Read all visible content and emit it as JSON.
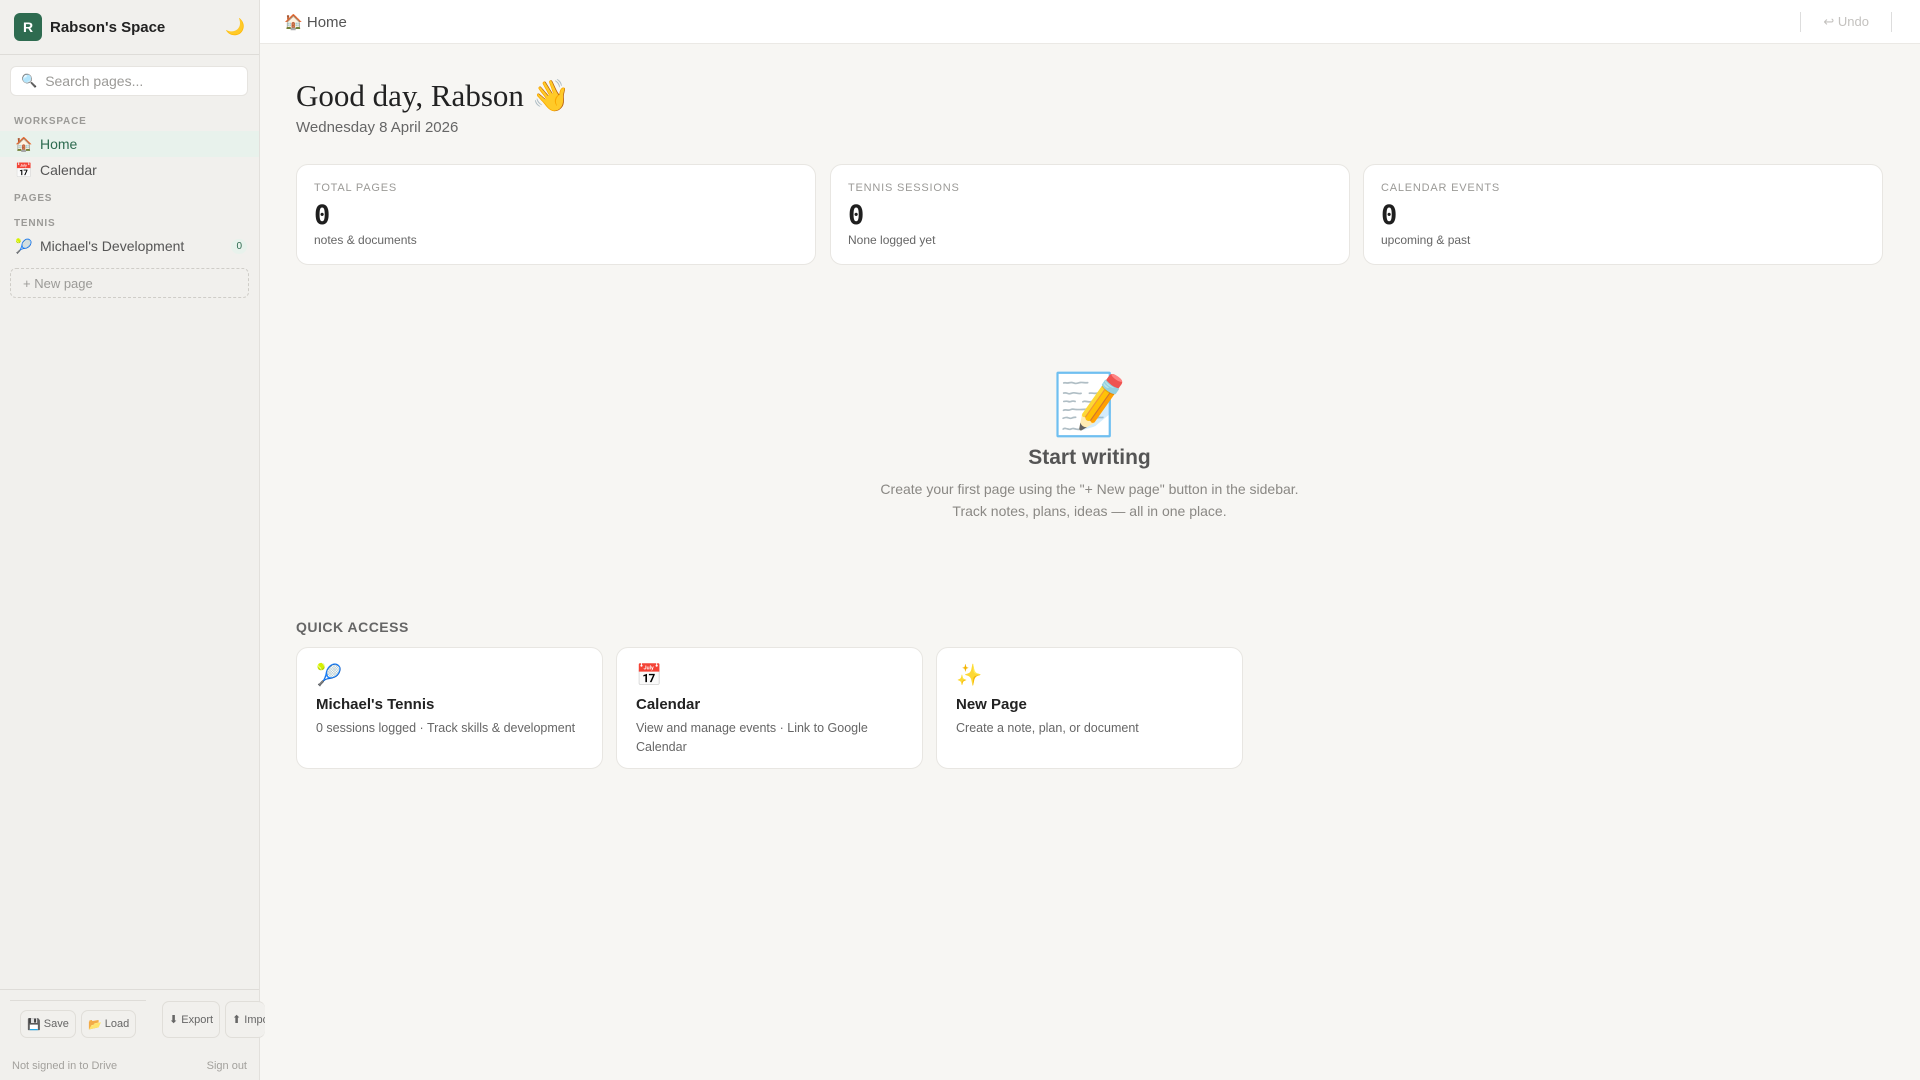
{
  "sidebar": {
    "logo_letter": "R",
    "workspace_name": "Rabson's Space",
    "search_placeholder": "Search pages...",
    "sections": {
      "workspace": "WORKSPACE",
      "pages": "PAGES",
      "tennis": "TENNIS"
    },
    "items": [
      {
        "label": "Home",
        "icon": "🏠"
      },
      {
        "label": "Calendar",
        "icon": "📅"
      },
      {
        "label": "Michael's Development",
        "icon": "🎾",
        "count": "0"
      }
    ],
    "new_page": "+ New page",
    "footer": {
      "save": "Save",
      "load": "Load",
      "export": "Export",
      "import": "Import",
      "status": "Not signed in to Drive",
      "sign_out": "Sign out"
    }
  },
  "topbar": {
    "breadcrumb": "Home",
    "breadcrumb_icon": "🏠",
    "undo": "↩ Undo"
  },
  "main": {
    "greeting": "Good day, Rabson 👋",
    "date": "Wednesday 8 April 2026",
    "stats": [
      {
        "label": "TOTAL PAGES",
        "value": "0",
        "sub": "notes & documents"
      },
      {
        "label": "TENNIS SESSIONS",
        "value": "0",
        "sub": "None logged yet"
      },
      {
        "label": "CALENDAR EVENTS",
        "value": "0",
        "sub": "upcoming & past"
      }
    ],
    "empty": {
      "icon": "📝",
      "title": "Start writing",
      "line1": "Create your first page using the \"+ New page\" button in the sidebar.",
      "line2": "Track notes, plans, ideas — all in one place."
    },
    "quick_access_label": "QUICK ACCESS",
    "quick": [
      {
        "icon": "🎾",
        "title": "Michael's Tennis",
        "desc": "0 sessions logged · Track skills & development"
      },
      {
        "icon": "📅",
        "title": "Calendar",
        "desc": "View and manage events · Link to Google Calendar"
      },
      {
        "icon": "✨",
        "title": "New Page",
        "desc": "Create a note, plan, or document"
      }
    ]
  },
  "colors": {
    "accent": "#2e6b50",
    "background": "#f7f6f3",
    "sidebar": "#f1f0ed"
  }
}
